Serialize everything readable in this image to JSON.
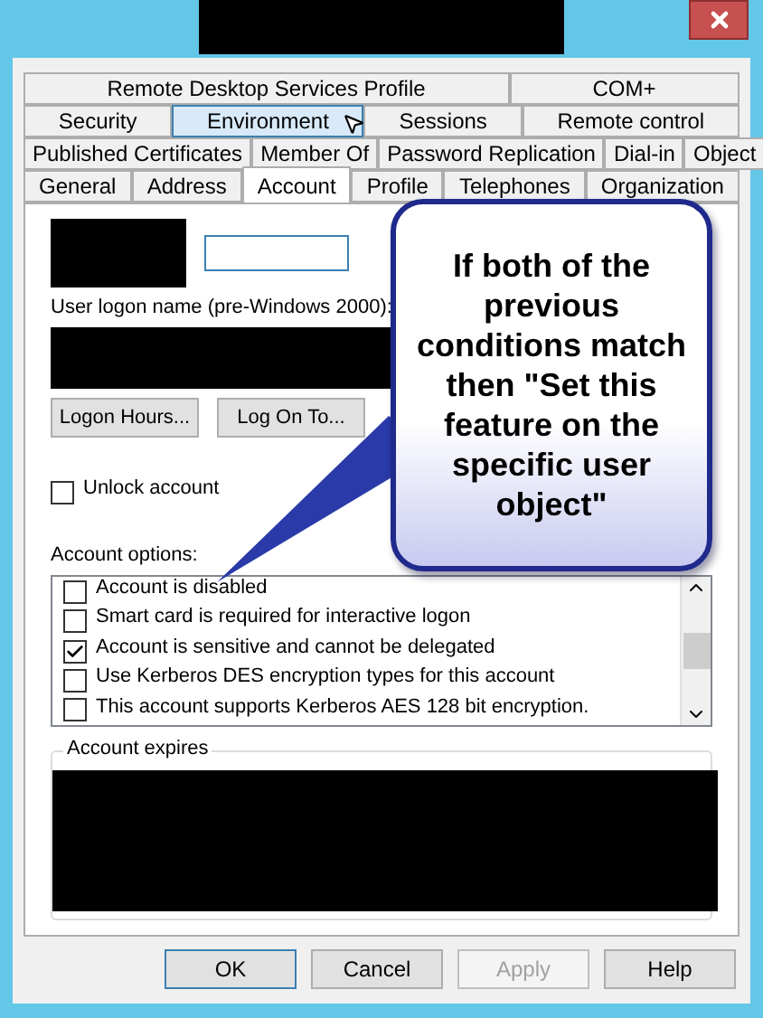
{
  "tab_rows": [
    {
      "tabs": [
        {
          "label": "Remote Desktop Services Profile",
          "selected": false,
          "hovered": false
        },
        {
          "label": "COM+",
          "selected": false,
          "hovered": false
        }
      ]
    },
    {
      "tabs": [
        {
          "label": "Security",
          "selected": false,
          "hovered": false
        },
        {
          "label": "Environment",
          "selected": false,
          "hovered": true
        },
        {
          "label": "Sessions",
          "selected": false,
          "hovered": false
        },
        {
          "label": "Remote control",
          "selected": false,
          "hovered": false
        }
      ]
    },
    {
      "tabs": [
        {
          "label": "Published Certificates",
          "selected": false,
          "hovered": false
        },
        {
          "label": "Member Of",
          "selected": false,
          "hovered": false
        },
        {
          "label": "Password Replication",
          "selected": false,
          "hovered": false
        },
        {
          "label": "Dial-in",
          "selected": false,
          "hovered": false
        },
        {
          "label": "Object",
          "selected": false,
          "hovered": false
        }
      ]
    },
    {
      "tabs": [
        {
          "label": "General",
          "selected": false,
          "hovered": false
        },
        {
          "label": "Address",
          "selected": false,
          "hovered": false
        },
        {
          "label": "Account",
          "selected": true,
          "hovered": false
        },
        {
          "label": "Profile",
          "selected": false,
          "hovered": false
        },
        {
          "label": "Telephones",
          "selected": false,
          "hovered": false
        },
        {
          "label": "Organization",
          "selected": false,
          "hovered": false
        }
      ]
    }
  ],
  "pre2000_label": "User logon name (pre-Windows 2000):",
  "logon_buttons": [
    "Logon Hours...",
    "Log On To..."
  ],
  "unlock": {
    "label": "Unlock account",
    "checked": false
  },
  "options_label": "Account options:",
  "options": [
    {
      "label": "Account is disabled",
      "checked": false
    },
    {
      "label": "Smart card is required for interactive logon",
      "checked": false
    },
    {
      "label": "Account is sensitive and cannot be delegated",
      "checked": true
    },
    {
      "label": "Use Kerberos DES encryption types for this account",
      "checked": false
    },
    {
      "label": "This account supports Kerberos AES 128 bit encryption.",
      "checked": false
    }
  ],
  "expires_label": "Account expires",
  "buttons": [
    {
      "label": "OK",
      "default": true,
      "disabled": false
    },
    {
      "label": "Cancel",
      "default": false,
      "disabled": false
    },
    {
      "label": "Apply",
      "default": false,
      "disabled": true
    },
    {
      "label": "Help",
      "default": false,
      "disabled": false
    }
  ],
  "callout": {
    "text": "If both of the previous conditions match then \"Set this feature on the specific user object\""
  }
}
